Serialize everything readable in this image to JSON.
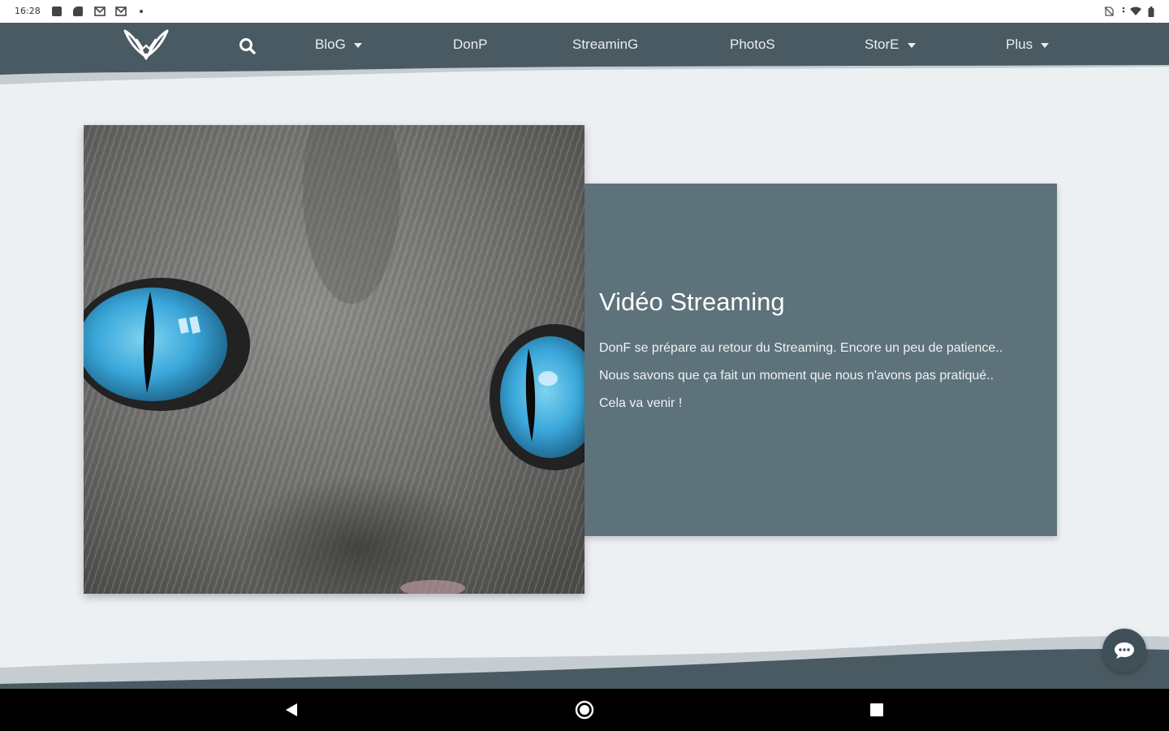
{
  "status_bar": {
    "time": "16:28"
  },
  "nav": {
    "items": [
      {
        "label": "BloG",
        "has_dropdown": true
      },
      {
        "label": "DonP",
        "has_dropdown": false
      },
      {
        "label": "StreaminG",
        "has_dropdown": false
      },
      {
        "label": "PhotoS",
        "has_dropdown": false
      },
      {
        "label": "StorE",
        "has_dropdown": true
      },
      {
        "label": "Plus",
        "has_dropdown": true
      }
    ],
    "icons": [
      "fox-logo-icon",
      "search-icon"
    ]
  },
  "hero": {
    "image": "cat-eyes-closeup",
    "title": "Vidéo Streaming",
    "body": "DonF se prépare au retour du Streaming. Encore un peu de patience.. Nous savons que ça fait un moment que nous n'avons pas pratiqué.. Cela va venir !"
  },
  "chat": {
    "icon": "chat-bubble-icon"
  },
  "system_nav": {
    "icons": [
      "back-icon",
      "home-icon",
      "recents-icon"
    ]
  },
  "colors": {
    "nav_bg": "#4a5a62",
    "panel_bg": "#5e727b",
    "page_bg": "#ecf0f3",
    "chat_bg": "#3f5058"
  }
}
